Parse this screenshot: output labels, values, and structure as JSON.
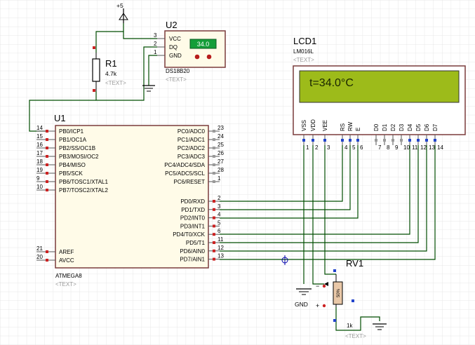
{
  "power": {
    "label": "+5"
  },
  "ground": {
    "label": "GND"
  },
  "text_placeholder": "<TEXT>",
  "r1": {
    "ref": "R1",
    "value": "4.7k"
  },
  "u2": {
    "ref": "U2",
    "part": "DS18B20",
    "display": "34.0",
    "pins": [
      {
        "num": "3",
        "name": "VCC"
      },
      {
        "num": "2",
        "name": "DQ"
      },
      {
        "num": "1",
        "name": "GND"
      }
    ]
  },
  "lcd": {
    "ref": "LCD1",
    "part": "LM016L",
    "screen": "t=34.0°C",
    "pins": [
      {
        "num": "1",
        "name": "VSS"
      },
      {
        "num": "2",
        "name": "VDD"
      },
      {
        "num": "3",
        "name": "VEE"
      },
      {
        "num": "4",
        "name": "RS"
      },
      {
        "num": "5",
        "name": "RW"
      },
      {
        "num": "6",
        "name": "E"
      },
      {
        "num": "7",
        "name": "D0"
      },
      {
        "num": "8",
        "name": "D1"
      },
      {
        "num": "9",
        "name": "D2"
      },
      {
        "num": "10",
        "name": "D3"
      },
      {
        "num": "11",
        "name": "D4"
      },
      {
        "num": "12",
        "name": "D5"
      },
      {
        "num": "13",
        "name": "D6"
      },
      {
        "num": "14",
        "name": "D7"
      }
    ]
  },
  "u1": {
    "ref": "U1",
    "part": "ATMEGA8",
    "left_pins": [
      {
        "num": "14",
        "name": "PB0/ICP1"
      },
      {
        "num": "15",
        "name": "PB1/OC1A"
      },
      {
        "num": "16",
        "name": "PB2/SS/OC1B"
      },
      {
        "num": "17",
        "name": "PB3/MOSI/OC2"
      },
      {
        "num": "18",
        "name": "PB4/MISO"
      },
      {
        "num": "19",
        "name": "PB5/SCK"
      },
      {
        "num": "9",
        "name": "PB6/TOSC1/XTAL1"
      },
      {
        "num": "10",
        "name": "PB7/TOSC2/XTAL2"
      }
    ],
    "left_pins_bottom": [
      {
        "num": "21",
        "name": "AREF"
      },
      {
        "num": "20",
        "name": "AVCC"
      }
    ],
    "right_pins_c": [
      {
        "num": "23",
        "name": "PC0/ADC0"
      },
      {
        "num": "24",
        "name": "PC1/ADC1"
      },
      {
        "num": "25",
        "name": "PC2/ADC2"
      },
      {
        "num": "26",
        "name": "PC3/ADC3"
      },
      {
        "num": "27",
        "name": "PC4/ADC4/SDA"
      },
      {
        "num": "28",
        "name": "PC5/ADC5/SCL"
      },
      {
        "num": "1",
        "name": "PC6/RESET"
      }
    ],
    "right_pins_d": [
      {
        "num": "2",
        "name": "PD0/RXD"
      },
      {
        "num": "3",
        "name": "PD1/TXD"
      },
      {
        "num": "4",
        "name": "PD2/INT0"
      },
      {
        "num": "5",
        "name": "PD3/INT1"
      },
      {
        "num": "6",
        "name": "PD4/T0/XCK"
      },
      {
        "num": "11",
        "name": "PD5/T1"
      },
      {
        "num": "12",
        "name": "PD6/AIN0"
      },
      {
        "num": "13",
        "name": "PD7/AIN1"
      }
    ]
  },
  "rv1": {
    "ref": "RV1",
    "value": "1k",
    "percent": "50%"
  }
}
